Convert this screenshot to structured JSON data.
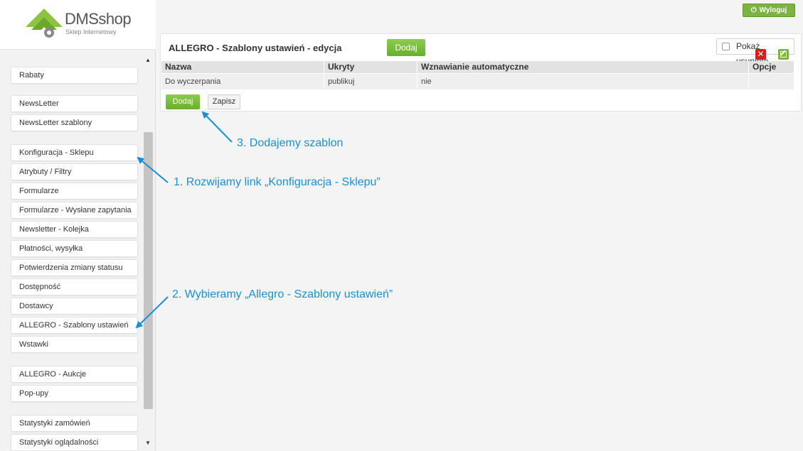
{
  "logo": {
    "title": "DMSshop",
    "subtitle": "Sklep Internetowy"
  },
  "header": {
    "logout_label": "Wyloguj"
  },
  "sidebar": {
    "items": [
      {
        "label": "Rabaty"
      },
      {
        "label": "NewsLetter"
      },
      {
        "label": "NewsLetter szablony"
      },
      {
        "label": "Konfiguracja - Sklepu"
      },
      {
        "label": "Atrybuty / Filtry"
      },
      {
        "label": "Formularze"
      },
      {
        "label": "Formularze - Wysłane zapytania"
      },
      {
        "label": "Newsletter - Kolejka"
      },
      {
        "label": "Płatności, wysyłka"
      },
      {
        "label": "Potwierdzenia zmiany statusu"
      },
      {
        "label": "Dostępność"
      },
      {
        "label": "Dostawcy"
      },
      {
        "label": "ALLEGRO - Szablony ustawień"
      },
      {
        "label": "Wstawki"
      },
      {
        "label": "ALLEGRO - Aukcje"
      },
      {
        "label": "Pop-upy"
      },
      {
        "label": "Statystyki zamówień"
      },
      {
        "label": "Statystyki oglądalności"
      }
    ]
  },
  "panel": {
    "title": "ALLEGRO - Szablony ustawień - edycja",
    "add_label": "Dodaj",
    "show_deleted_label": "Pokaż usunięte",
    "columns": [
      "Nazwa",
      "Ukryty",
      "Wznawianie automatyczne",
      "Opcje"
    ],
    "rows": [
      {
        "nazwa": "Do wyczerpania",
        "ukryty": "publikuj",
        "wznawianie": "nie"
      }
    ],
    "bottom_add_label": "Dodaj",
    "save_label": "Zapisz"
  },
  "annotations": {
    "step1": "1. Rozwijamy link „Konfiguracja - Sklepu”",
    "step2": "2. Wybieramy „Allegro - Szablony ustawień”",
    "step3": "3. Dodajemy szablon",
    "color": "#1a8fd5"
  },
  "colors": {
    "accent_green": "#7cb342",
    "delete_red": "#d32020"
  }
}
